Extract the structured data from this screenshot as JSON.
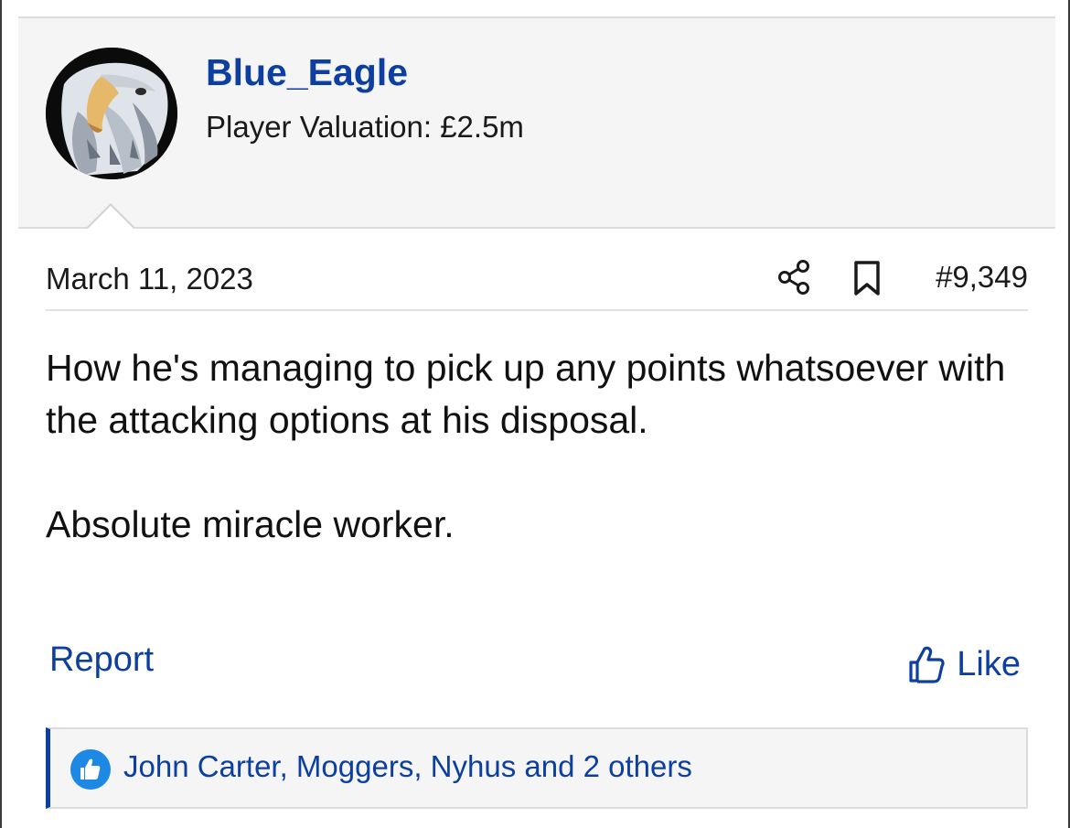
{
  "post": {
    "author": {
      "username": "Blue_Eagle",
      "title": "Player Valuation: £2.5m",
      "avatar_icon": "eagle-avatar"
    },
    "date": "March 11, 2023",
    "number": "#9,349",
    "body": [
      "How he's managing to pick up any points whatsoever with the attacking options at his disposal.",
      "Absolute miracle worker."
    ],
    "actions": {
      "report_label": "Report",
      "like_label": "Like",
      "share_icon": "share-icon",
      "bookmark_icon": "bookmark-icon"
    },
    "reactions": {
      "text": "John Carter, Moggers, Nyhus and 2 others",
      "icon": "thumbs-up-icon"
    }
  },
  "colors": {
    "link": "#0d3fa1",
    "reaction_badge": "#1e88e5",
    "header_bg": "#f5f5f5"
  }
}
